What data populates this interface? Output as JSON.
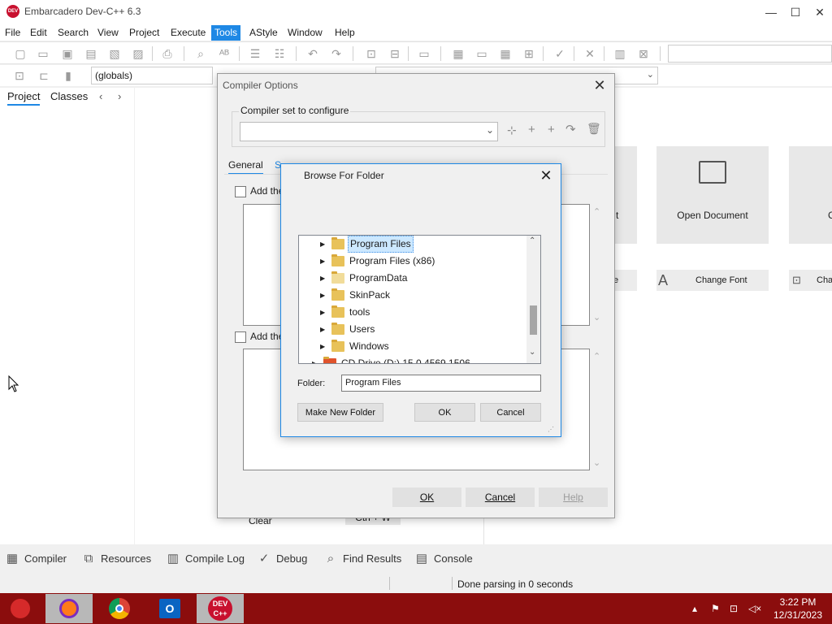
{
  "app": {
    "title": "Embarcadero Dev-C++ 6.3",
    "icon_text": "DEV C++",
    "brand_color": "#c8102e"
  },
  "window_controls": {
    "minimize": "—",
    "maximize": "☐",
    "close": "✕"
  },
  "menubar": {
    "items": [
      "File",
      "Edit",
      "Search",
      "View",
      "Project",
      "Execute",
      "Tools",
      "AStyle",
      "Window",
      "Help"
    ],
    "active": "Tools",
    "accent": "#1e88e5"
  },
  "toolbar2": {
    "globals": "(globals)"
  },
  "left_panel": {
    "tabs": [
      "Project",
      "Classes"
    ],
    "active_tab": "Project"
  },
  "welcome": {
    "open_document": "Open Document",
    "change_font": "Change Font",
    "partial_right": "C",
    "partial_cha": "Cha",
    "partial_e": "e",
    "partial_t": "t"
  },
  "behind_text": {
    "clear": "Clear",
    "shortcut": "Ctrl + W"
  },
  "compiler_dialog": {
    "title": "Compiler Options",
    "groupbox_label": "Compiler set to configure",
    "combo_value": "",
    "tabs": [
      "General",
      "S"
    ],
    "active_tab": "General",
    "checkbox1": "Add the",
    "checkbox2": "Add the",
    "buttons": {
      "ok": "OK",
      "cancel": "Cancel",
      "help": "Help"
    }
  },
  "browse_dialog": {
    "title": "Browse For Folder",
    "tree": [
      {
        "label": "Program Files",
        "selected": true
      },
      {
        "label": "Program Files (x86)",
        "selected": false
      },
      {
        "label": "ProgramData",
        "selected": false
      },
      {
        "label": "SkinPack",
        "selected": false
      },
      {
        "label": "tools",
        "selected": false
      },
      {
        "label": "Users",
        "selected": false
      },
      {
        "label": "Windows",
        "selected": false
      },
      {
        "label": "CD Drive (D:) 15.0.4569.1506",
        "selected": false
      }
    ],
    "folder_label": "Folder:",
    "folder_value": "Program Files",
    "buttons": {
      "make_new_folder": "Make New Folder",
      "ok": "OK",
      "cancel": "Cancel"
    }
  },
  "bottom_tabs": {
    "items": [
      {
        "label": "Compiler",
        "icon": "grid-icon"
      },
      {
        "label": "Resources",
        "icon": "resources-icon"
      },
      {
        "label": "Compile Log",
        "icon": "chart-icon"
      },
      {
        "label": "Debug",
        "icon": "check-icon"
      },
      {
        "label": "Find Results",
        "icon": "find-icon"
      },
      {
        "label": "Console",
        "icon": "console-icon"
      }
    ]
  },
  "status": {
    "text": "Done parsing in 0 seconds"
  },
  "taskbar": {
    "apps": [
      "firefox-icon",
      "chrome-icon",
      "outlook-icon",
      "devcpp-icon"
    ],
    "active_app": "devcpp-icon",
    "devcpp_text": "DEV C++",
    "time": "3:22 PM",
    "date": "12/31/2023",
    "color": "#8b0d0d"
  }
}
